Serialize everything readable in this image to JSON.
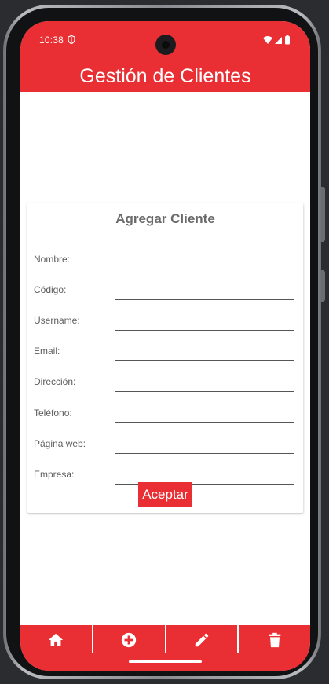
{
  "status_bar": {
    "time": "10:38",
    "icons": [
      "shield-icon",
      "wifi-icon",
      "signal-icon",
      "battery-icon"
    ]
  },
  "app_bar": {
    "title": "Gestión de Clientes",
    "color": "#e92f34"
  },
  "form": {
    "title": "Agregar Cliente",
    "fields": [
      {
        "label": "Nombre:",
        "value": ""
      },
      {
        "label": "Código:",
        "value": ""
      },
      {
        "label": "Username:",
        "value": ""
      },
      {
        "label": "Email:",
        "value": ""
      },
      {
        "label": "Dirección:",
        "value": ""
      },
      {
        "label": "Teléfono:",
        "value": ""
      },
      {
        "label": "Página web:",
        "value": ""
      },
      {
        "label": "Empresa:",
        "value": ""
      }
    ],
    "submit_label": "Aceptar"
  },
  "bottom_nav": {
    "items": [
      {
        "icon": "home-icon"
      },
      {
        "icon": "add-circle-icon"
      },
      {
        "icon": "edit-pencil-icon"
      },
      {
        "icon": "trash-icon"
      }
    ]
  }
}
